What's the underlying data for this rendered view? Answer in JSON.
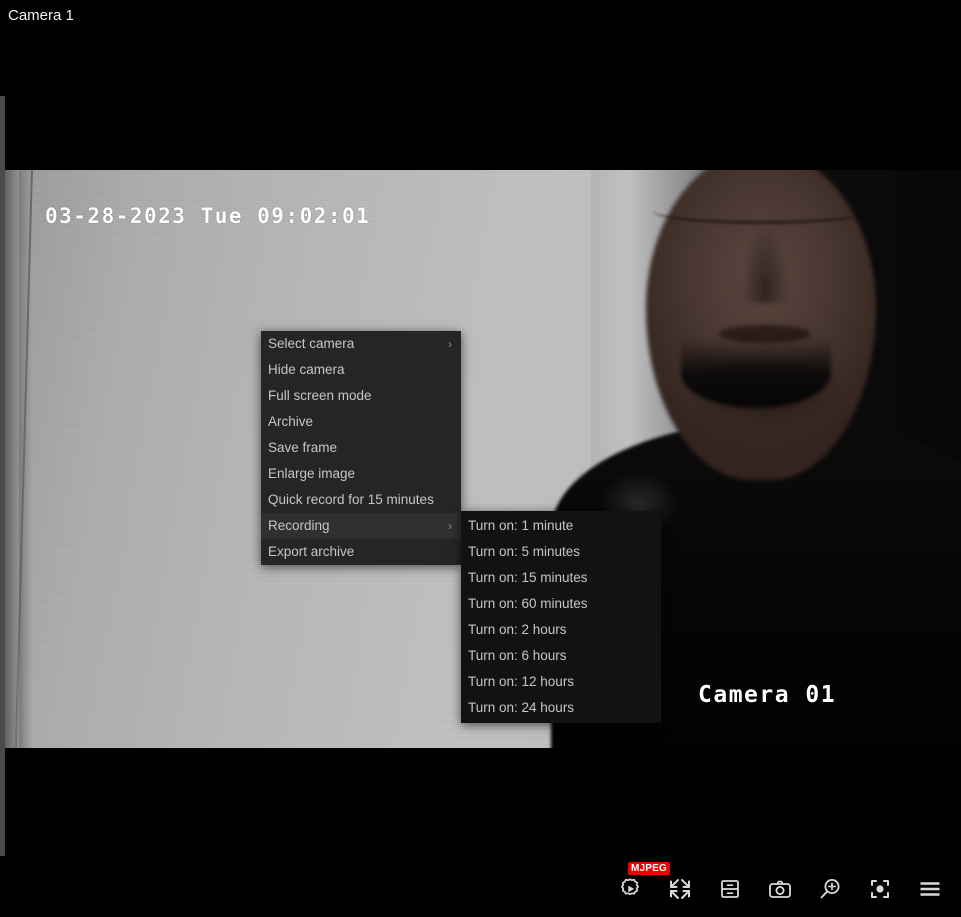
{
  "window": {
    "camera_title": "Camera 1",
    "background_color": "#000000"
  },
  "video": {
    "timestamp_overlay": "03-28-2023 Tue 09:02:01",
    "camera_label_overlay": "Camera 01"
  },
  "context_menu": {
    "items": [
      {
        "label": "Select camera",
        "has_submenu": true,
        "highlighted": false,
        "chevron": "›"
      },
      {
        "label": "Hide camera",
        "has_submenu": false,
        "highlighted": false,
        "chevron": ""
      },
      {
        "label": "Full screen mode",
        "has_submenu": false,
        "highlighted": false,
        "chevron": ""
      },
      {
        "label": "Archive",
        "has_submenu": false,
        "highlighted": false,
        "chevron": ""
      },
      {
        "label": "Save frame",
        "has_submenu": false,
        "highlighted": false,
        "chevron": ""
      },
      {
        "label": "Enlarge image",
        "has_submenu": false,
        "highlighted": false,
        "chevron": ""
      },
      {
        "label": "Quick record for 15 minutes",
        "has_submenu": false,
        "highlighted": false,
        "chevron": ""
      },
      {
        "label": "Recording",
        "has_submenu": true,
        "highlighted": true,
        "chevron": "›"
      },
      {
        "label": "Export archive",
        "has_submenu": false,
        "highlighted": false,
        "chevron": ""
      }
    ],
    "background_color": "#252525",
    "highlight_color": "#303030",
    "text_color": "#c8c6c1"
  },
  "recording_submenu": {
    "parent": "Recording",
    "items": [
      {
        "label": "Turn on: 1 minute"
      },
      {
        "label": "Turn on: 5 minutes"
      },
      {
        "label": "Turn on: 15 minutes"
      },
      {
        "label": "Turn on: 60 minutes"
      },
      {
        "label": "Turn on: 2 hours"
      },
      {
        "label": "Turn on: 6 hours"
      },
      {
        "label": "Turn on: 12 hours"
      },
      {
        "label": "Turn on: 24 hours"
      }
    ],
    "background_color": "#121212"
  },
  "toolbar": {
    "stream_badge": "MJPEG",
    "stream_badge_color": "#ef0000",
    "buttons": [
      {
        "name": "stream-settings",
        "icon": "gear-play-icon",
        "label": "Stream settings"
      },
      {
        "name": "fullscreen",
        "icon": "expand-arrows-icon",
        "label": "Full screen"
      },
      {
        "name": "archive",
        "icon": "archive-drawer-icon",
        "label": "Archive"
      },
      {
        "name": "snapshot",
        "icon": "camera-icon",
        "label": "Save frame"
      },
      {
        "name": "zoom-in",
        "icon": "magnifier-plus-icon",
        "label": "Enlarge image"
      },
      {
        "name": "focus",
        "icon": "focus-target-icon",
        "label": "Focus"
      },
      {
        "name": "menu",
        "icon": "hamburger-icon",
        "label": "Menu"
      }
    ]
  }
}
